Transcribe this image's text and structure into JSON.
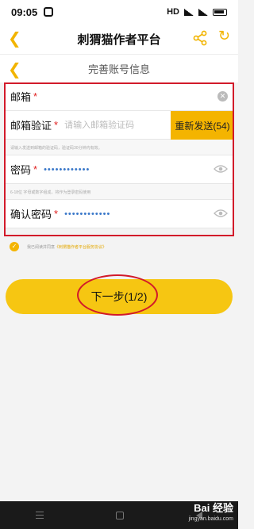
{
  "status_bar": {
    "time": "09:05",
    "network": "HD"
  },
  "header": {
    "title": "刺猬猫作者平台",
    "back_icon": "chevron-left-icon",
    "share_icon": "share-icon",
    "refresh_icon": "refresh-icon"
  },
  "sub_header": {
    "title": "完善账号信息",
    "back_icon": "chevron-left-icon"
  },
  "form": {
    "email": {
      "label": "邮箱",
      "star": "*",
      "value": ""
    },
    "code": {
      "label": "邮箱验证",
      "star": "*",
      "placeholder": "请输入邮箱验证码",
      "resend_label": "重新发送(54)",
      "hint": "请输入发送到邮箱的验证码，验证码30分钟内有效。"
    },
    "password": {
      "label": "密码",
      "star": "*",
      "value": "••••••••••••",
      "hint": "6-18位 字母或数字组成，将作为登录密码使用"
    },
    "confirm": {
      "label": "确认密码",
      "star": "*",
      "value": "••••••••••••"
    }
  },
  "agreement": {
    "text": "我已阅读并同意",
    "link": "《刺猬猫作者平台服务协议》"
  },
  "next_button": {
    "label": "下一步(1/2)"
  },
  "watermark": {
    "text": "Bai 经验",
    "sub": "jingyan.baidu.com"
  },
  "colors": {
    "accent": "#f4b400",
    "button": "#f6c612",
    "annotation": "#d21a2a",
    "password_dots": "#3a78c9"
  }
}
